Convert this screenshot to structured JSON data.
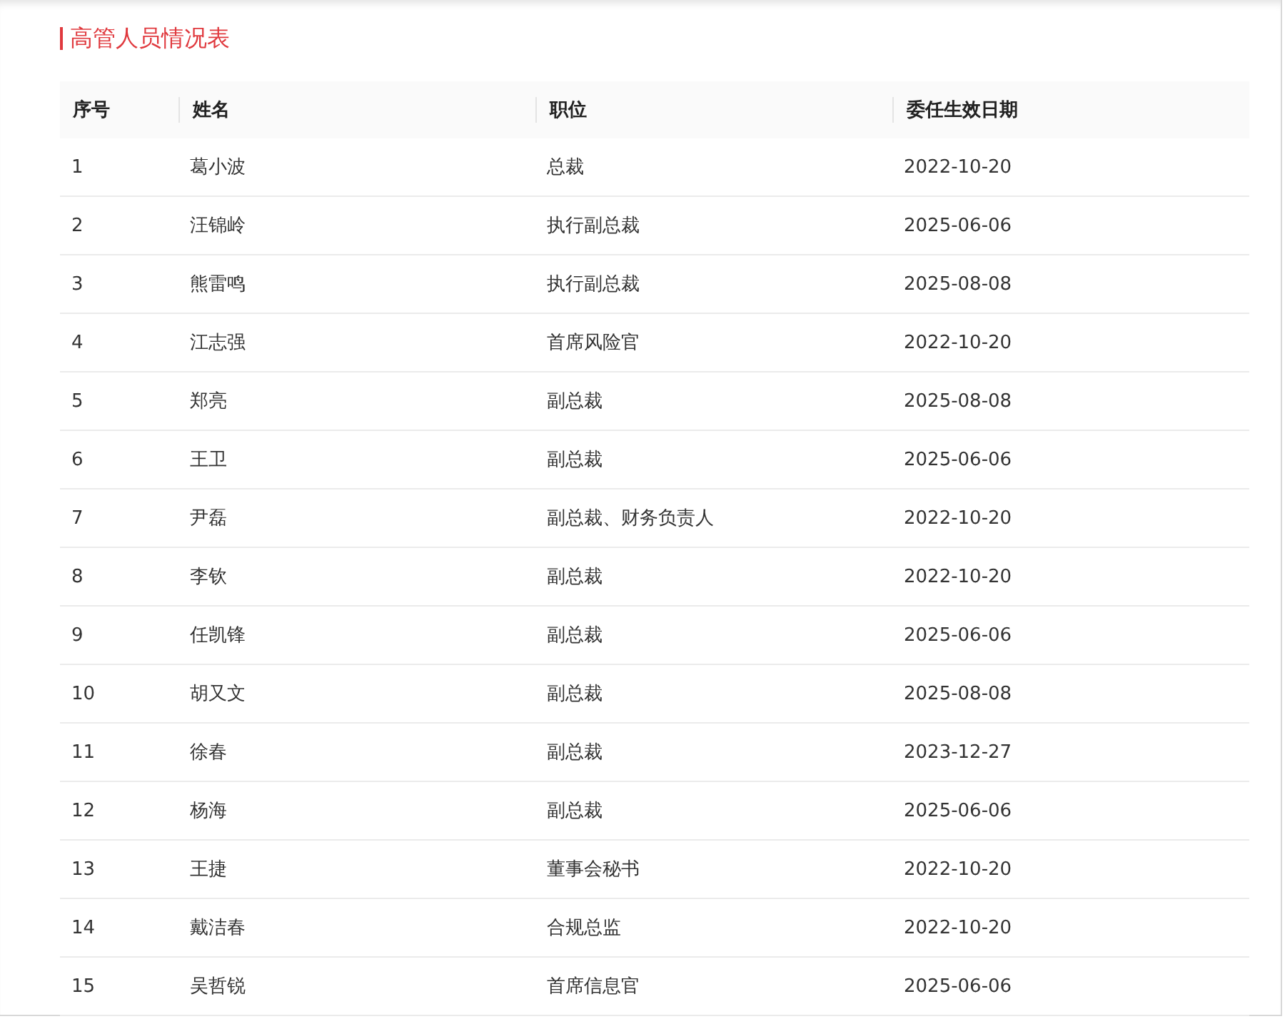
{
  "title": "高管人员情况表",
  "table": {
    "columns": [
      "序号",
      "姓名",
      "职位",
      "委任生效日期"
    ],
    "rows": [
      [
        "1",
        "葛小波",
        "总裁",
        "2022-10-20"
      ],
      [
        "2",
        "汪锦岭",
        "执行副总裁",
        "2025-06-06"
      ],
      [
        "3",
        "熊雷鸣",
        "执行副总裁",
        "2025-08-08"
      ],
      [
        "4",
        "江志强",
        "首席风险官",
        "2022-10-20"
      ],
      [
        "5",
        "郑亮",
        "副总裁",
        "2025-08-08"
      ],
      [
        "6",
        "王卫",
        "副总裁",
        "2025-06-06"
      ],
      [
        "7",
        "尹磊",
        "副总裁、财务负责人",
        "2022-10-20"
      ],
      [
        "8",
        "李钦",
        "副总裁",
        "2022-10-20"
      ],
      [
        "9",
        "任凯锋",
        "副总裁",
        "2025-06-06"
      ],
      [
        "10",
        "胡又文",
        "副总裁",
        "2025-08-08"
      ],
      [
        "11",
        "徐春",
        "副总裁",
        "2023-12-27"
      ],
      [
        "12",
        "杨海",
        "副总裁",
        "2025-06-06"
      ],
      [
        "13",
        "王捷",
        "董事会秘书",
        "2022-10-20"
      ],
      [
        "14",
        "戴洁春",
        "合规总监",
        "2022-10-20"
      ],
      [
        "15",
        "吴哲锐",
        "首席信息官",
        "2025-06-06"
      ]
    ]
  }
}
